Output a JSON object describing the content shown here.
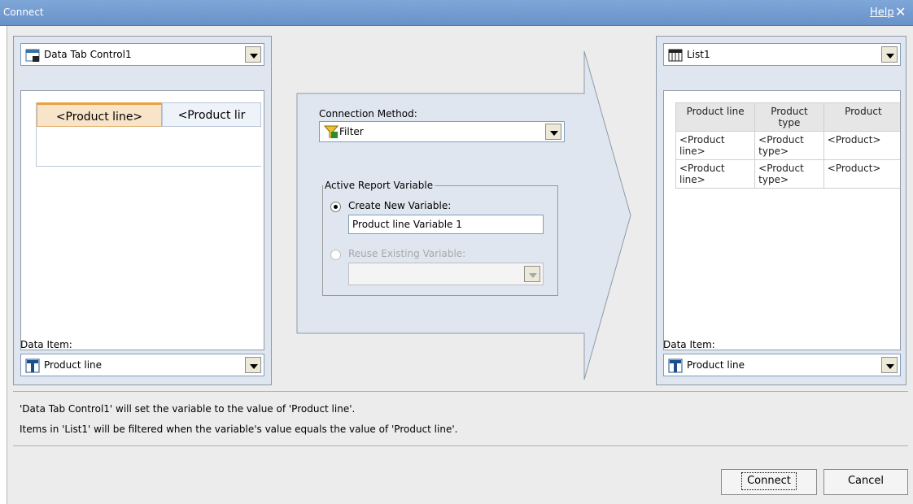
{
  "title_bar": {
    "title": "Connect",
    "help_label": "Help",
    "close_glyph": "✕"
  },
  "left_panel": {
    "source_select": {
      "value": "Data Tab Control1",
      "icon": "data-tab-control-icon"
    },
    "tabs": [
      {
        "label": "<Product line>",
        "active": true
      },
      {
        "label": "<Product lir",
        "active": false
      }
    ],
    "data_item_label": "Data Item:",
    "data_item_select": {
      "value": "Product line",
      "icon": "data-item-icon"
    }
  },
  "middle_panel": {
    "connection_method_label": "Connection Method:",
    "connection_method_select": {
      "value": "Filter",
      "icon": "filter-icon"
    },
    "active_variable_legend": "Active Report Variable",
    "create_new_label": "Create New Variable:",
    "create_new_value": "Product line Variable 1",
    "reuse_existing_label": "Reuse Existing Variable:",
    "reuse_existing_value": ""
  },
  "right_panel": {
    "target_select": {
      "value": "List1",
      "icon": "list-icon"
    },
    "table": {
      "headers": [
        "Product line",
        "Product type",
        "Product"
      ],
      "rows": [
        [
          "<Product line>",
          "<Product type>",
          "<Product>"
        ],
        [
          "<Product line>",
          "<Product type>",
          "<Product>"
        ]
      ]
    },
    "data_item_label": "Data Item:",
    "data_item_select": {
      "value": "Product line",
      "icon": "data-item-icon"
    }
  },
  "summary": {
    "line1": "'Data Tab Control1' will set the variable to the value of 'Product line'.",
    "line2": "Items in 'List1' will be filtered when the variable's value equals the value of 'Product line'."
  },
  "buttons": {
    "connect": "Connect",
    "cancel": "Cancel"
  },
  "colors": {
    "title_bar": "#6892c9",
    "panel_bg": "#dfe6f0",
    "active_tab": "#f8e4c8"
  }
}
